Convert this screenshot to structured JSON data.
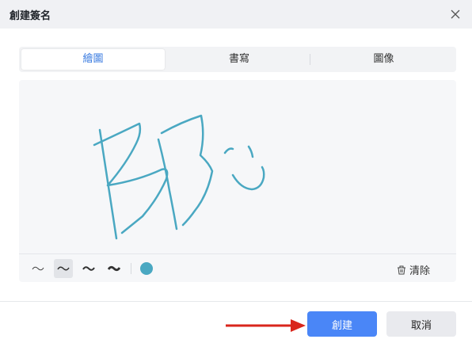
{
  "dialog": {
    "title": "創建簽名",
    "close_icon": "close-icon"
  },
  "tabs": [
    {
      "label": "繪圖",
      "active": true
    },
    {
      "label": "書寫",
      "active": false
    },
    {
      "label": "圖像",
      "active": false
    }
  ],
  "canvas": {
    "stroke_color": "#4aa8c2",
    "tools": [
      {
        "icon": "thin-stroke-icon",
        "selected": false
      },
      {
        "icon": "medium-stroke-icon",
        "selected": true
      },
      {
        "icon": "thick-stroke-icon",
        "selected": false
      },
      {
        "icon": "thickest-stroke-icon",
        "selected": false
      }
    ],
    "selected_color": "#4aa8c2",
    "clear_label": "清除",
    "clear_icon": "trash-icon"
  },
  "footer": {
    "create_label": "創建",
    "cancel_label": "取消",
    "accent_color": "#4a86f7",
    "annotation_arrow_color": "#d9261c"
  }
}
